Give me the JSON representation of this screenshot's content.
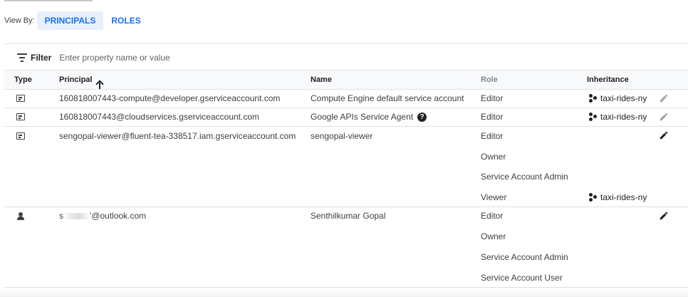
{
  "view_by": {
    "label": "View By:",
    "tabs": [
      {
        "label": "PRINCIPALS",
        "active": true
      },
      {
        "label": "ROLES",
        "active": false
      }
    ]
  },
  "filter": {
    "label": "Filter",
    "placeholder": "Enter property name or value"
  },
  "table": {
    "columns": {
      "type": "Type",
      "principal": "Principal",
      "name": "Name",
      "role": "Role",
      "inheritance": "Inheritance"
    },
    "sort": {
      "column": "principal",
      "direction": "ascending"
    },
    "rows": [
      {
        "type_icon": "service-account-icon",
        "principal": "160818007443-compute@developer.gserviceaccount.com",
        "name": "Compute Engine default service account",
        "roles": [
          "Editor"
        ],
        "inheritance": "taxi-rides-ny",
        "edit_enabled": false
      },
      {
        "type_icon": "service-account-icon",
        "principal": "160818007443@cloudservices.gserviceaccount.com",
        "name": "Google APIs Service Agent",
        "name_help_icon": "help-icon",
        "roles": [
          "Editor"
        ],
        "inheritance": "taxi-rides-ny",
        "edit_enabled": false
      },
      {
        "type_icon": "service-account-icon",
        "principal": "sengopal-viewer@fluent-tea-338517.iam.gserviceaccount.com",
        "name": "sengopal-viewer",
        "roles": [
          "Editor",
          "Owner",
          "Service Account Admin",
          "Viewer"
        ],
        "inheritance": "taxi-rides-ny",
        "edit_enabled": true
      },
      {
        "type_icon": "person-icon",
        "principal_prefix": "s",
        "principal_suffix": "'@outlook.com",
        "name": "Senthilkumar Gopal",
        "roles": [
          "Editor",
          "Owner",
          "Service Account Admin",
          "Service Account User"
        ],
        "edit_enabled": true
      }
    ]
  },
  "colors": {
    "accent": "#1a73e8",
    "active_tab_bg": "#e8f0fe",
    "header_bg": "#f8f9fa",
    "border": "#e0e0e0"
  }
}
